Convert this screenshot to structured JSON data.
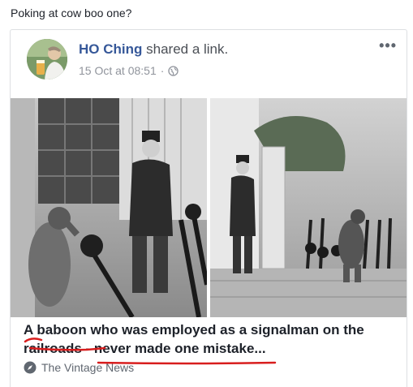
{
  "caption": "Poking at cow boo one?",
  "post": {
    "author": "HO Ching",
    "action": "shared a link.",
    "timestamp": "15 Oct at 08:51",
    "separator": "·",
    "more_label": "•••"
  },
  "link": {
    "headline": "A baboon who was employed as a signalman on the railroads - never made one mistake...",
    "source": "The Vintage News"
  },
  "colors": {
    "author": "#365899",
    "meta": "#90949c",
    "scribble": "#d81e1e"
  },
  "icons": {
    "visibility": "globe-icon",
    "source": "compass-icon",
    "more": "more-options-icon"
  }
}
